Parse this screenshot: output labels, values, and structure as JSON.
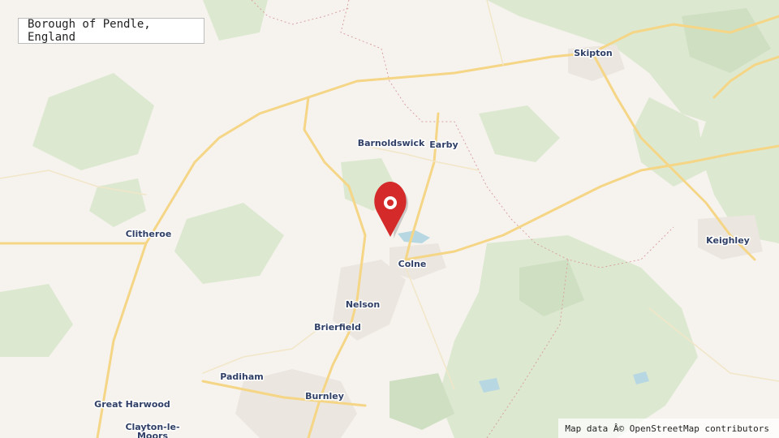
{
  "title": "Borough of Pendle, England",
  "attribution": "Map data Â© OpenStreetMap contributors",
  "marker": {
    "icon": "map-pin-icon",
    "color": "#d42a2a"
  },
  "places": [
    {
      "id": "skipton",
      "name": "Skipton"
    },
    {
      "id": "barnoldswick",
      "name": "Barnoldswick"
    },
    {
      "id": "earby",
      "name": "Earby"
    },
    {
      "id": "clitheroe",
      "name": "Clitheroe"
    },
    {
      "id": "keighley",
      "name": "Keighley"
    },
    {
      "id": "colne",
      "name": "Colne"
    },
    {
      "id": "nelson",
      "name": "Nelson"
    },
    {
      "id": "brierfield",
      "name": "Brierfield"
    },
    {
      "id": "padiham",
      "name": "Padiham"
    },
    {
      "id": "burnley",
      "name": "Burnley"
    },
    {
      "id": "great-harwood",
      "name": "Great Harwood"
    },
    {
      "id": "clayton-le",
      "name": "Clayton-le-"
    },
    {
      "id": "moors",
      "name": "Moors"
    }
  ],
  "colors": {
    "land": "#f6f3ee",
    "green": "#dbe7cf",
    "road": "#f7d68a",
    "water": "#aad3df",
    "urban": "#ece8e2"
  }
}
